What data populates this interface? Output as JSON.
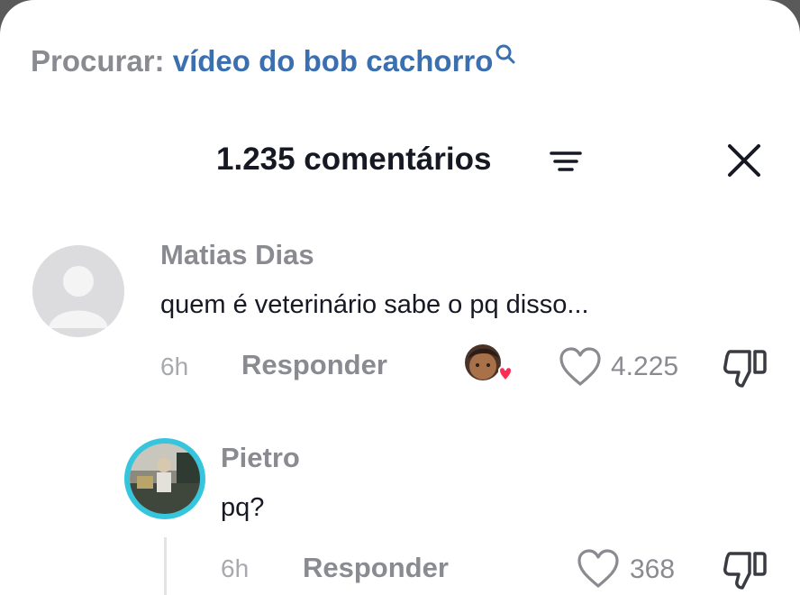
{
  "search": {
    "label": "Procurar:",
    "term": "vídeo do bob cachorro"
  },
  "header": {
    "title": "1.235 comentários"
  },
  "comments": [
    {
      "author": "Matias Dias",
      "text": "quem é veterinário sabe o pq disso...",
      "time": "6h",
      "reply_label": "Responder",
      "likes": "4.225"
    },
    {
      "author": "Pietro",
      "text": "pq?",
      "time": "6h",
      "reply_label": "Responder",
      "likes": "368"
    }
  ],
  "colors": {
    "accent_link": "#3a6fb0",
    "avatar_ring": "#35c5dd",
    "heart_badge": "#fe2c55"
  }
}
